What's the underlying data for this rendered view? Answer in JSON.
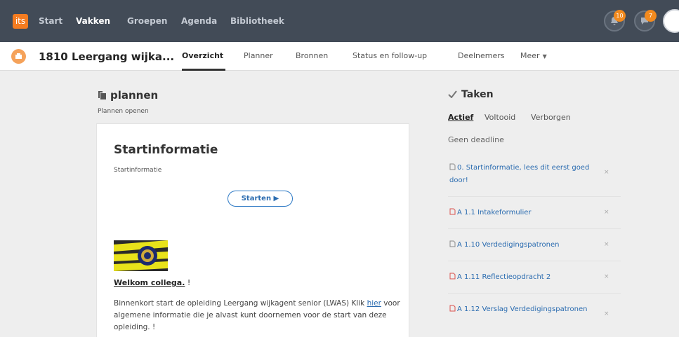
{
  "topbar": {
    "logo_text": "its",
    "nav": [
      "Start",
      "Vakken",
      "Groepen",
      "Agenda",
      "Bibliotheek"
    ],
    "active_nav": "Vakken",
    "notifications_count": "10",
    "messages_count": "7",
    "bg_color": "#424b57",
    "badge_color": "#f28a1e"
  },
  "course": {
    "title": "1810 Leergang wijka...",
    "tabs": [
      "Overzicht",
      "Planner",
      "Bronnen",
      "Status en follow-up",
      "Deelnemers",
      "Meer"
    ],
    "active_tab": "Overzicht"
  },
  "plannen": {
    "heading": "plannen",
    "subtitle": "Plannen openen",
    "card": {
      "title": "Startinformatie",
      "subtitle": "Startinformatie",
      "start_button": "Starten ▶",
      "welcome_link": "Welkom collega.",
      "welcome_suffix": " !",
      "para_before": "Binnenkort start de opleiding Leergang wijkagent senior (LWAS) Klik ",
      "para_link": "hier",
      "para_after": " voor algemene informatie die je alvast kunt doornemen voor de start van deze opleiding. !"
    }
  },
  "taken": {
    "heading": "Taken",
    "tabs": [
      "Actief",
      "Voltooid",
      "Verborgen"
    ],
    "active_tab": "Actief",
    "deadline_label": "Geen deadline",
    "tasks": [
      {
        "label": "0. Startinformatie, lees dit eerst goed door!",
        "icon": "document-icon"
      },
      {
        "label": "A 1.1 Intakeformulier",
        "icon": "assignment-icon"
      },
      {
        "label": "A 1.10 Verdedigingspatronen",
        "icon": "document-icon"
      },
      {
        "label": "A 1.11 Reflectieopdracht 2",
        "icon": "assignment-icon"
      },
      {
        "label": "A 1.12 Verslag Verdedigingspatronen",
        "icon": "assignment-icon"
      }
    ],
    "close_glyph": "×",
    "link_color": "#2b6cb0"
  }
}
